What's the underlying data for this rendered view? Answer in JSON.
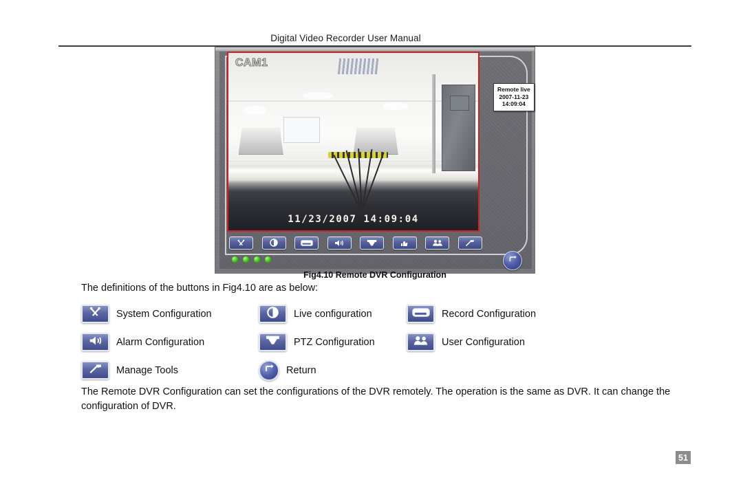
{
  "document": {
    "header_title": "Digital Video Recorder User Manual",
    "page_number": "51"
  },
  "figure": {
    "caption": "Fig4.10 Remote DVR Configuration",
    "camera_label": "CAM1",
    "video_timestamp": "11/23/2007 14:09:04",
    "overlay": {
      "title": "Remote live",
      "date": "2007-11-23",
      "time": "14:09:04"
    },
    "toolbar_buttons": [
      {
        "name": "system-configuration",
        "icon": "wrench-icon"
      },
      {
        "name": "live-configuration",
        "icon": "contrast-icon"
      },
      {
        "name": "record-configuration",
        "icon": "record-icon"
      },
      {
        "name": "alarm-configuration",
        "icon": "speaker-icon"
      },
      {
        "name": "ptz-configuration",
        "icon": "dome-camera-icon"
      },
      {
        "name": "manage-tools-alt",
        "icon": "hand-icon"
      },
      {
        "name": "user-configuration",
        "icon": "users-icon"
      },
      {
        "name": "manage-tools",
        "icon": "hammer-icon"
      }
    ],
    "status_leds": 4,
    "return_button": {
      "icon": "return-icon"
    }
  },
  "body": {
    "intro": "The definitions of the buttons in Fig4.10 are as below:",
    "closing": "The Remote DVR Configuration can set the configurations of the DVR remotely. The operation is the same as DVR. It can change the configuration of DVR."
  },
  "legend": {
    "rows": [
      [
        {
          "icon": "wrench-icon",
          "label": "System Configuration",
          "shape": "rect"
        },
        {
          "icon": "contrast-icon",
          "label": "Live configuration",
          "shape": "rect"
        },
        {
          "icon": "record-icon",
          "label": "Record Configuration",
          "shape": "rect"
        }
      ],
      [
        {
          "icon": "speaker-icon",
          "label": "Alarm Configuration",
          "shape": "rect"
        },
        {
          "icon": "dome-camera-icon",
          "label": "PTZ Configuration",
          "shape": "rect"
        },
        {
          "icon": "users-icon",
          "label": "User Configuration",
          "shape": "rect"
        }
      ],
      [
        {
          "icon": "hammer-icon",
          "label": "Manage Tools",
          "shape": "rect"
        },
        {
          "icon": "return-icon",
          "label": "Return",
          "shape": "round"
        },
        null
      ]
    ]
  },
  "colors": {
    "video_border": "#cc2222",
    "button_blue": "#4b5ba6",
    "led_green": "#54cf2a",
    "page_badge": "#8c8c8c"
  }
}
